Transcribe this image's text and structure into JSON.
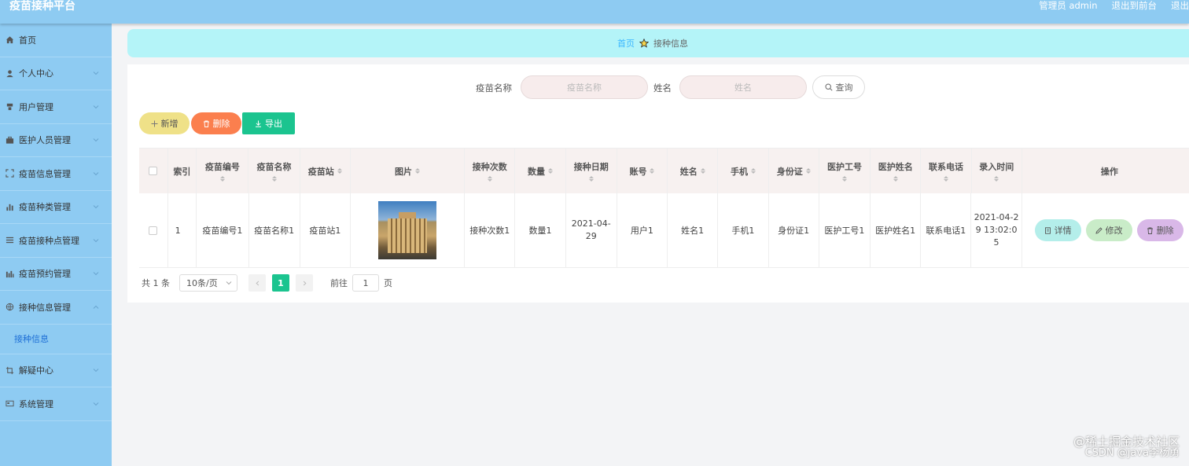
{
  "header": {
    "app_title": "疫苗接种平台",
    "user_label": "管理员 admin",
    "goto_front": "退出到前台",
    "logout": "退出"
  },
  "sidebar": {
    "items": [
      {
        "label": "首页",
        "icon": "home-icon"
      },
      {
        "label": "个人中心",
        "icon": "user-icon"
      },
      {
        "label": "用户管理",
        "icon": "users-icon"
      },
      {
        "label": "医护人员管理",
        "icon": "briefcase-icon"
      },
      {
        "label": "疫苗信息管理",
        "icon": "frame-icon"
      },
      {
        "label": "疫苗种类管理",
        "icon": "bar-chart-icon"
      },
      {
        "label": "疫苗接种点管理",
        "icon": "list-icon"
      },
      {
        "label": "疫苗预约管理",
        "icon": "chart-icon"
      },
      {
        "label": "接种信息管理",
        "icon": "globe-icon"
      },
      {
        "label": "解疑中心",
        "icon": "crop-icon"
      },
      {
        "label": "系统管理",
        "icon": "card-icon"
      }
    ],
    "submenu_active": "接种信息"
  },
  "breadcrumb": {
    "home": "首页",
    "current": "接种信息"
  },
  "search": {
    "vaccine_name_label": "疫苗名称",
    "vaccine_name_placeholder": "疫苗名称",
    "name_label": "姓名",
    "name_placeholder": "姓名",
    "search_button": "查询"
  },
  "actions": {
    "add": "新增",
    "delete": "删除",
    "export": "导出"
  },
  "table": {
    "columns": [
      "索引",
      "疫苗编号",
      "疫苗名称",
      "疫苗站",
      "图片",
      "接种次数",
      "数量",
      "接种日期",
      "账号",
      "姓名",
      "手机",
      "身份证",
      "医护工号",
      "医护姓名",
      "联系电话",
      "录入时间",
      "操作"
    ],
    "rows": [
      {
        "index": "1",
        "vaccine_no": "疫苗编号1",
        "vaccine_name": "疫苗名称1",
        "station": "疫苗站1",
        "times": "接种次数1",
        "quantity": "数量1",
        "date": "2021-04-29",
        "account": "用户1",
        "name": "姓名1",
        "phone": "手机1",
        "id_card": "身份证1",
        "staff_no": "医护工号1",
        "staff_name": "医护姓名1",
        "contact": "联系电话1",
        "created": "2021-04-29 13:02:05"
      }
    ],
    "row_actions": {
      "detail": "详情",
      "edit": "修改",
      "delete": "删除"
    }
  },
  "pagination": {
    "total": "共 1 条",
    "page_size": "10条/页",
    "current_page": "1",
    "goto_label": "前往",
    "goto_value": "1",
    "page_suffix": "页"
  },
  "watermark": {
    "line1": "@稀土掘金技术社区",
    "line2": "CSDN @java李杨勇"
  },
  "colors": {
    "topbar": "#8ecbf2",
    "breadcrumb_bg": "#b4f4f8",
    "primary_green": "#1bc48f",
    "add_btn": "#efe188",
    "delete_btn": "#fb7f4e"
  }
}
